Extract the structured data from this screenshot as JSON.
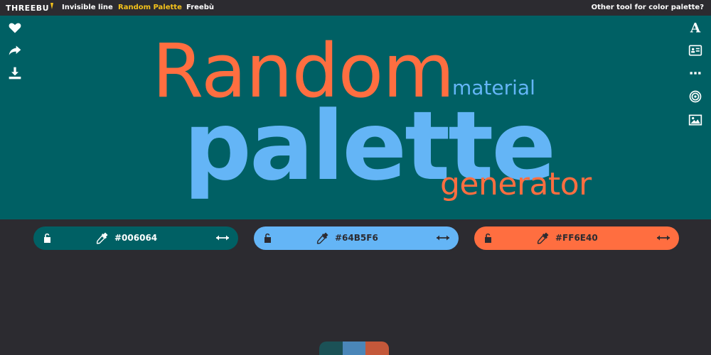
{
  "nav": {
    "logo": "THREEBU",
    "links": [
      "Invisible line",
      "Random Palette",
      "Freebù"
    ],
    "right_link": "Other tool for color palette?"
  },
  "hero": {
    "word_random": "Random",
    "word_material": "material",
    "word_palette": "palette",
    "word_generator": "generator",
    "background": "#006064"
  },
  "left_icons": [
    "heart-icon",
    "share-icon",
    "download-icon"
  ],
  "right_icons": [
    "font-icon",
    "card-icon",
    "dots-icon",
    "target-icon",
    "image-icon"
  ],
  "palette": [
    {
      "hex": "#006064",
      "bg": "#006064",
      "fg": "#ffffff",
      "lock": "unlocked"
    },
    {
      "hex": "#64B5F6",
      "bg": "#64b5f6",
      "fg": "#2c2b30",
      "lock": "unlocked"
    },
    {
      "hex": "#FF6E40",
      "bg": "#ff6e40",
      "fg": "#2c2b30",
      "lock": "unlocked"
    }
  ],
  "mini_palette": [
    "#1b5156",
    "#4a86b8",
    "#c4583a"
  ],
  "colors": {
    "dark_bg": "#2c2b30",
    "active_nav": "#f4c21b"
  }
}
